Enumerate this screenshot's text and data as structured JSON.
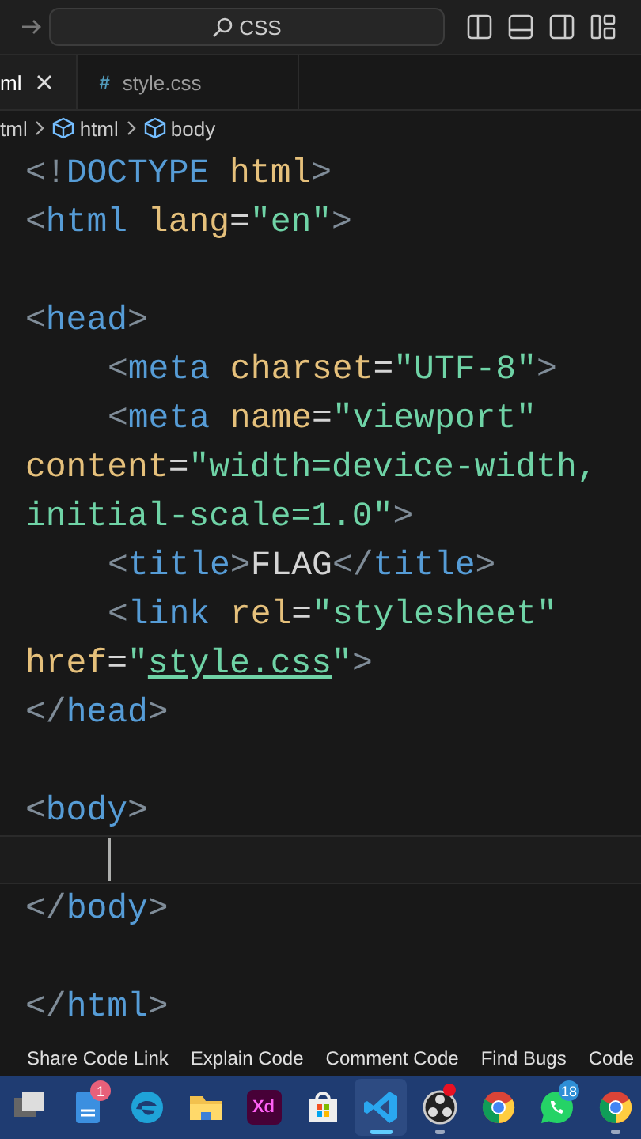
{
  "title_bar": {
    "search": "CSS"
  },
  "tabs": [
    {
      "label": "ml",
      "kind": "html",
      "selected": true
    },
    {
      "label": "style.css",
      "kind": "css",
      "icon": "#",
      "selected": false
    }
  ],
  "breadcrumb": [
    "tml",
    "html",
    "body"
  ],
  "code_lines": [
    {
      "indented": false,
      "current": false,
      "tokens": [
        {
          "kind": "bracket",
          "text": "<!"
        },
        {
          "kind": "tag",
          "text": "DOCTYPE "
        },
        {
          "kind": "attr",
          "text": "html"
        },
        {
          "kind": "bracket",
          "text": ">"
        }
      ]
    },
    {
      "indented": false,
      "current": false,
      "tokens": [
        {
          "kind": "bracket",
          "text": "<"
        },
        {
          "kind": "tag",
          "text": "html "
        },
        {
          "kind": "attr",
          "text": "lang"
        },
        {
          "kind": "plain",
          "text": "="
        },
        {
          "kind": "string",
          "text": "\"en\""
        },
        {
          "kind": "bracket",
          "text": ">"
        }
      ]
    },
    {
      "current": false
    },
    {
      "indented": false,
      "current": false,
      "tokens": [
        {
          "kind": "bracket",
          "text": "<"
        },
        {
          "kind": "tag",
          "text": "head"
        },
        {
          "kind": "bracket",
          "text": ">"
        }
      ]
    },
    {
      "indented": true,
      "current": false,
      "tokens": [
        {
          "kind": "bracket",
          "text": "<"
        },
        {
          "kind": "tag",
          "text": "meta "
        },
        {
          "kind": "attr",
          "text": "charset"
        },
        {
          "kind": "plain",
          "text": "="
        },
        {
          "kind": "string",
          "text": "\"UTF-8\""
        },
        {
          "kind": "bracket",
          "text": ">"
        }
      ]
    },
    {
      "indented": true,
      "current": false,
      "tokens": [
        {
          "kind": "bracket",
          "text": "<"
        },
        {
          "kind": "tag",
          "text": "meta "
        },
        {
          "kind": "attr",
          "text": "name"
        },
        {
          "kind": "plain",
          "text": "="
        },
        {
          "kind": "string",
          "text": "\"viewport\""
        }
      ]
    },
    {
      "indented": false,
      "current": false,
      "tokens": [
        {
          "kind": "attr",
          "text": "content"
        },
        {
          "kind": "plain",
          "text": "="
        },
        {
          "kind": "string",
          "text": "\"width=device-width,"
        }
      ]
    },
    {
      "indented": false,
      "current": false,
      "tokens": [
        {
          "kind": "string",
          "text": "initial-scale=1.0\""
        },
        {
          "kind": "bracket",
          "text": ">"
        }
      ]
    },
    {
      "indented": true,
      "current": false,
      "tokens": [
        {
          "kind": "bracket",
          "text": "<"
        },
        {
          "kind": "tag",
          "text": "title"
        },
        {
          "kind": "bracket",
          "text": ">"
        },
        {
          "kind": "plain",
          "text": "FLAG"
        },
        {
          "kind": "bracket",
          "text": "</"
        },
        {
          "kind": "tag",
          "text": "title"
        },
        {
          "kind": "bracket",
          "text": ">"
        }
      ]
    },
    {
      "indented": true,
      "current": false,
      "tokens": [
        {
          "kind": "bracket",
          "text": "<"
        },
        {
          "kind": "tag",
          "text": "link "
        },
        {
          "kind": "attr",
          "text": "rel"
        },
        {
          "kind": "plain",
          "text": "="
        },
        {
          "kind": "string",
          "text": "\"stylesheet\""
        }
      ]
    },
    {
      "indented": false,
      "current": false,
      "tokens": [
        {
          "kind": "attr",
          "text": "href"
        },
        {
          "kind": "plain",
          "text": "="
        },
        {
          "kind": "string",
          "text": "\""
        },
        {
          "kind": "link",
          "text": "style.css"
        },
        {
          "kind": "string",
          "text": "\""
        },
        {
          "kind": "bracket",
          "text": ">"
        }
      ]
    },
    {
      "indented": false,
      "current": false,
      "tokens": [
        {
          "kind": "bracket",
          "text": "</"
        },
        {
          "kind": "tag",
          "text": "head"
        },
        {
          "kind": "bracket",
          "text": ">"
        }
      ]
    },
    {
      "current": false
    },
    {
      "indented": false,
      "current": false,
      "tokens": [
        {
          "kind": "bracket",
          "text": "<"
        },
        {
          "kind": "tag",
          "text": "body"
        },
        {
          "kind": "bracket",
          "text": ">"
        }
      ]
    },
    {
      "indented": true,
      "current": true
    },
    {
      "indented": false,
      "current": false,
      "tokens": [
        {
          "kind": "bracket",
          "text": "</"
        },
        {
          "kind": "tag",
          "text": "body"
        },
        {
          "kind": "bracket",
          "text": ">"
        }
      ]
    },
    {
      "current": false
    },
    {
      "indented": false,
      "current": false,
      "tokens": [
        {
          "kind": "bracket",
          "text": "</"
        },
        {
          "kind": "tag",
          "text": "html"
        },
        {
          "kind": "bracket",
          "text": ">"
        }
      ]
    }
  ],
  "status_bar": [
    "Share Code Link",
    "Explain Code",
    "Comment Code",
    "Find Bugs",
    "Code"
  ],
  "taskbar": [
    {
      "kind": "taskview",
      "running": false,
      "active": false
    },
    {
      "kind": "notes",
      "badge": "1",
      "running": false,
      "active": false
    },
    {
      "kind": "edge",
      "running": false,
      "active": false
    },
    {
      "kind": "folder",
      "running": false,
      "active": false
    },
    {
      "kind": "xd",
      "label": "Xd",
      "running": false,
      "active": false
    },
    {
      "kind": "store",
      "running": false,
      "active": false
    },
    {
      "kind": "vscode",
      "running": true,
      "active": true
    },
    {
      "kind": "obs",
      "dot": true,
      "running": true,
      "active": false
    },
    {
      "kind": "chrome",
      "running": false,
      "active": false
    },
    {
      "kind": "whatsapp",
      "badge": "18",
      "running": false,
      "active": false
    },
    {
      "kind": "chrome",
      "running": true,
      "active": false
    }
  ]
}
